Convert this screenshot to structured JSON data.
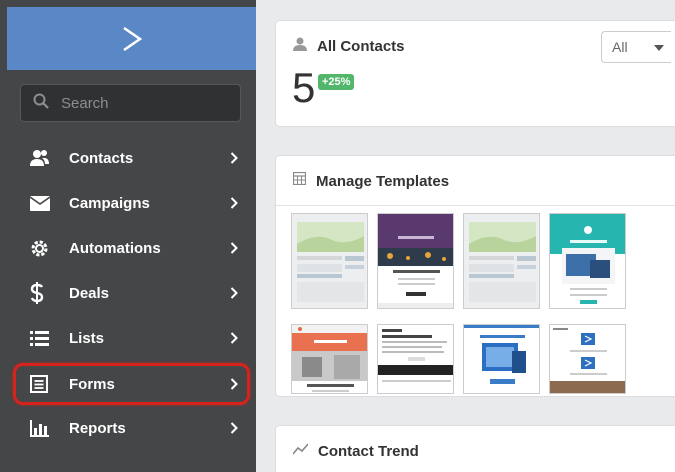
{
  "sidebar": {
    "search_placeholder": "Search",
    "items": [
      {
        "label": "Contacts",
        "icon": "contacts-icon"
      },
      {
        "label": "Campaigns",
        "icon": "envelope-icon"
      },
      {
        "label": "Automations",
        "icon": "gear-icon"
      },
      {
        "label": "Deals",
        "icon": "dollar-icon"
      },
      {
        "label": "Lists",
        "icon": "list-icon"
      },
      {
        "label": "Forms",
        "icon": "form-icon"
      },
      {
        "label": "Reports",
        "icon": "bar-chart-icon"
      }
    ],
    "highlighted_item": "Forms",
    "colors": {
      "header": "#5a87c5",
      "background": "#444648",
      "highlight": "#d8231c"
    }
  },
  "contacts_card": {
    "title": "All Contacts",
    "count": "5",
    "change_badge": "+25%",
    "filter_value": "All"
  },
  "templates_card": {
    "title": "Manage Templates"
  },
  "trend_card": {
    "title": "Contact Trend"
  }
}
